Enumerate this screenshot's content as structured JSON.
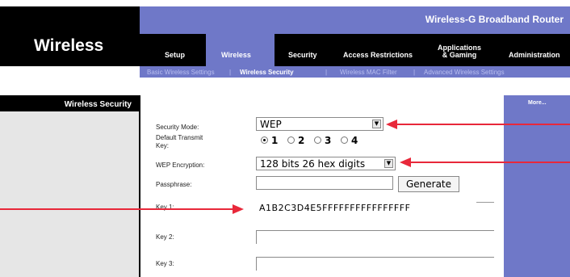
{
  "header": {
    "section_title": "Wireless",
    "product_name": "Wireless-G Broadband Router"
  },
  "tabs": [
    {
      "label": "Setup"
    },
    {
      "label": "Wireless"
    },
    {
      "label": "Security"
    },
    {
      "label": "Access Restrictions"
    },
    {
      "label": "Applications\n& Gaming"
    },
    {
      "label": "Administration"
    }
  ],
  "subnav": [
    {
      "label": "Basic Wireless Settings"
    },
    {
      "label": "|"
    },
    {
      "label": "Wireless Security"
    },
    {
      "label": "|"
    },
    {
      "label": "Wireless MAC Filter"
    },
    {
      "label": "|"
    },
    {
      "label": "Advanced Wireless Settings"
    }
  ],
  "sidebar": {
    "title": "Wireless Security"
  },
  "help": {
    "more": "More..."
  },
  "form": {
    "security_mode_label": "Security Mode:",
    "security_mode_value": "WEP",
    "default_key_label": "Default Transmit\nKey:",
    "default_key_options": [
      "1",
      "2",
      "3",
      "4"
    ],
    "default_key_selected": "1",
    "encryption_label": "WEP Encryption:",
    "encryption_value": "128 bits 26 hex digits",
    "passphrase_label": "Passphrase:",
    "passphrase_value": "",
    "generate_label": "Generate",
    "key1_label": "Key 1:",
    "key1_value": "A1B2C3D4E5FFFFFFFFFFFFFFFF",
    "key2_label": "Key 2:",
    "key2_value": "",
    "key3_label": "Key 3:",
    "key3_value": ""
  },
  "colors": {
    "accent": "#6f78c8",
    "arrow": "#e8283a",
    "header_bg": "#000000"
  }
}
